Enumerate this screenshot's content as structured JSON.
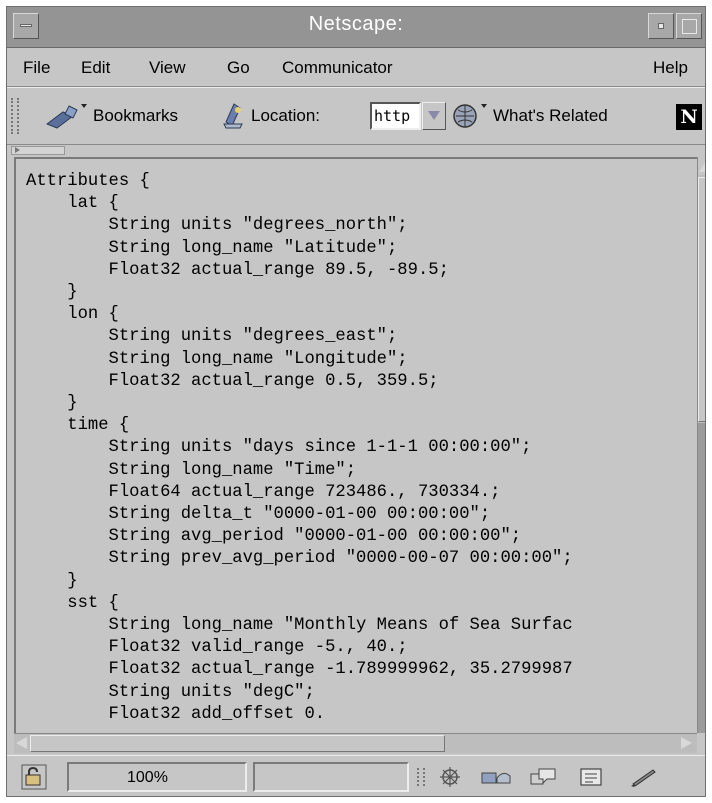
{
  "window": {
    "title": "Netscape:"
  },
  "menu": [
    "File",
    "Edit",
    "View",
    "Go",
    "Communicator",
    "Help"
  ],
  "toolbar": {
    "bookmarks_label": "Bookmarks",
    "location_label": "Location:",
    "location_value": "http",
    "whats_related_label": "What's Related",
    "netscape_logo_letter": "N"
  },
  "document": {
    "lines": [
      "Attributes {",
      "    lat {",
      "        String units \"degrees_north\";",
      "        String long_name \"Latitude\";",
      "        Float32 actual_range 89.5, -89.5;",
      "    }",
      "    lon {",
      "        String units \"degrees_east\";",
      "        String long_name \"Longitude\";",
      "        Float32 actual_range 0.5, 359.5;",
      "    }",
      "    time {",
      "        String units \"days since 1-1-1 00:00:00\";",
      "        String long_name \"Time\";",
      "        Float64 actual_range 723486., 730334.;",
      "        String delta_t \"0000-01-00 00:00:00\";",
      "        String avg_period \"0000-01-00 00:00:00\";",
      "        String prev_avg_period \"0000-00-07 00:00:00\";",
      "    }",
      "    sst {",
      "        String long_name \"Monthly Means of Sea Surfac",
      "        Float32 valid_range -5., 40.;",
      "        Float32 actual_range -1.789999962, 35.2799987",
      "        String units \"degC\";",
      "        Float32 add_offset 0."
    ]
  },
  "status": {
    "zoom": "100%"
  },
  "icons": {
    "window_menu": "window-menu-icon",
    "minimize": "minimize-icon",
    "maximize": "maximize-icon",
    "bookmarks": "bookmarks-icon",
    "location": "location-icon",
    "whats_related": "whats-related-icon",
    "security": "padlock-icon"
  },
  "colors": {
    "chrome": "#c6c6c6",
    "titlebar": "#949494",
    "text": "#000000"
  }
}
